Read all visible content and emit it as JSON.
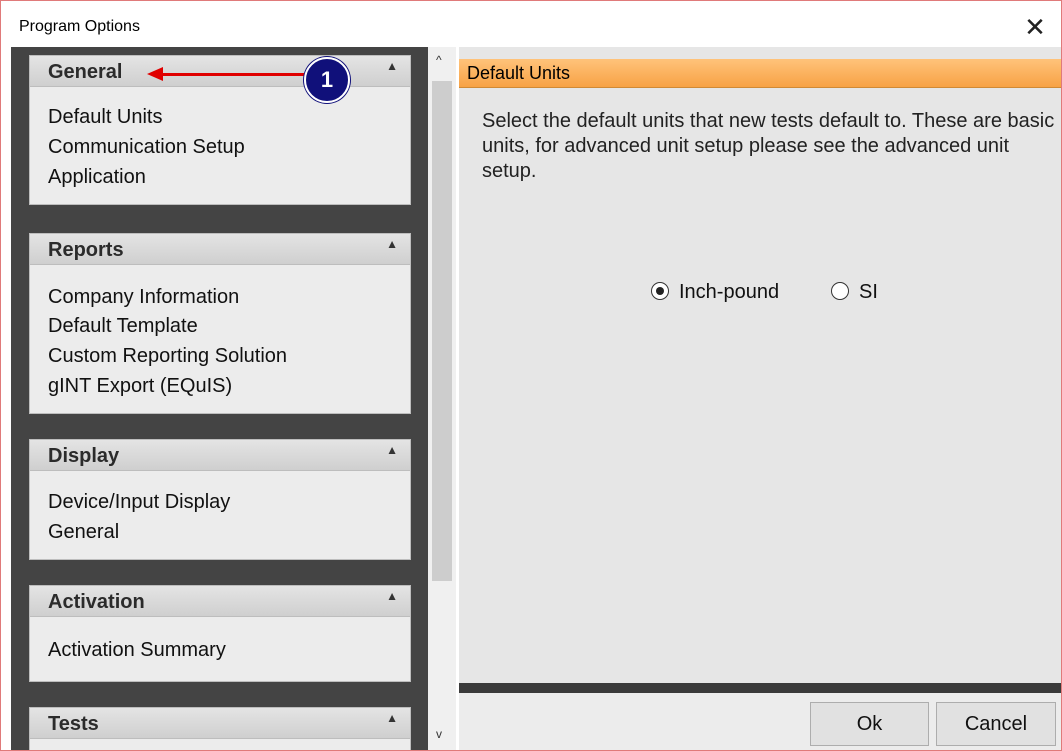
{
  "window": {
    "title": "Program Options",
    "close_glyph": "✕"
  },
  "sidebar": {
    "collapse_glyph": "▲",
    "sections": [
      {
        "title": "General",
        "items": [
          "Default Units",
          "Communication Setup",
          "Application"
        ]
      },
      {
        "title": "Reports",
        "items": [
          "Company Information",
          "Default Template",
          "Custom Reporting Solution",
          "gINT Export (EQuIS)"
        ]
      },
      {
        "title": "Display",
        "items": [
          "Device/Input Display",
          "General"
        ]
      },
      {
        "title": "Activation",
        "items": [
          "Activation Summary"
        ]
      },
      {
        "title": "Tests",
        "items": []
      }
    ]
  },
  "scrollbar": {
    "up_glyph": "^",
    "down_glyph": "v"
  },
  "annotation": {
    "callout_number": "1",
    "arrow_color": "#e00000",
    "callout_color": "#10107a"
  },
  "content": {
    "header": "Default Units",
    "header_color": "#f7a245",
    "description": "Select the default units that new tests default to.  These are basic units, for advanced unit setup please see the advanced unit setup.",
    "units": {
      "options": [
        "Inch-pound",
        "SI"
      ],
      "selected": "Inch-pound"
    }
  },
  "buttons": {
    "ok": "Ok",
    "cancel": "Cancel"
  }
}
